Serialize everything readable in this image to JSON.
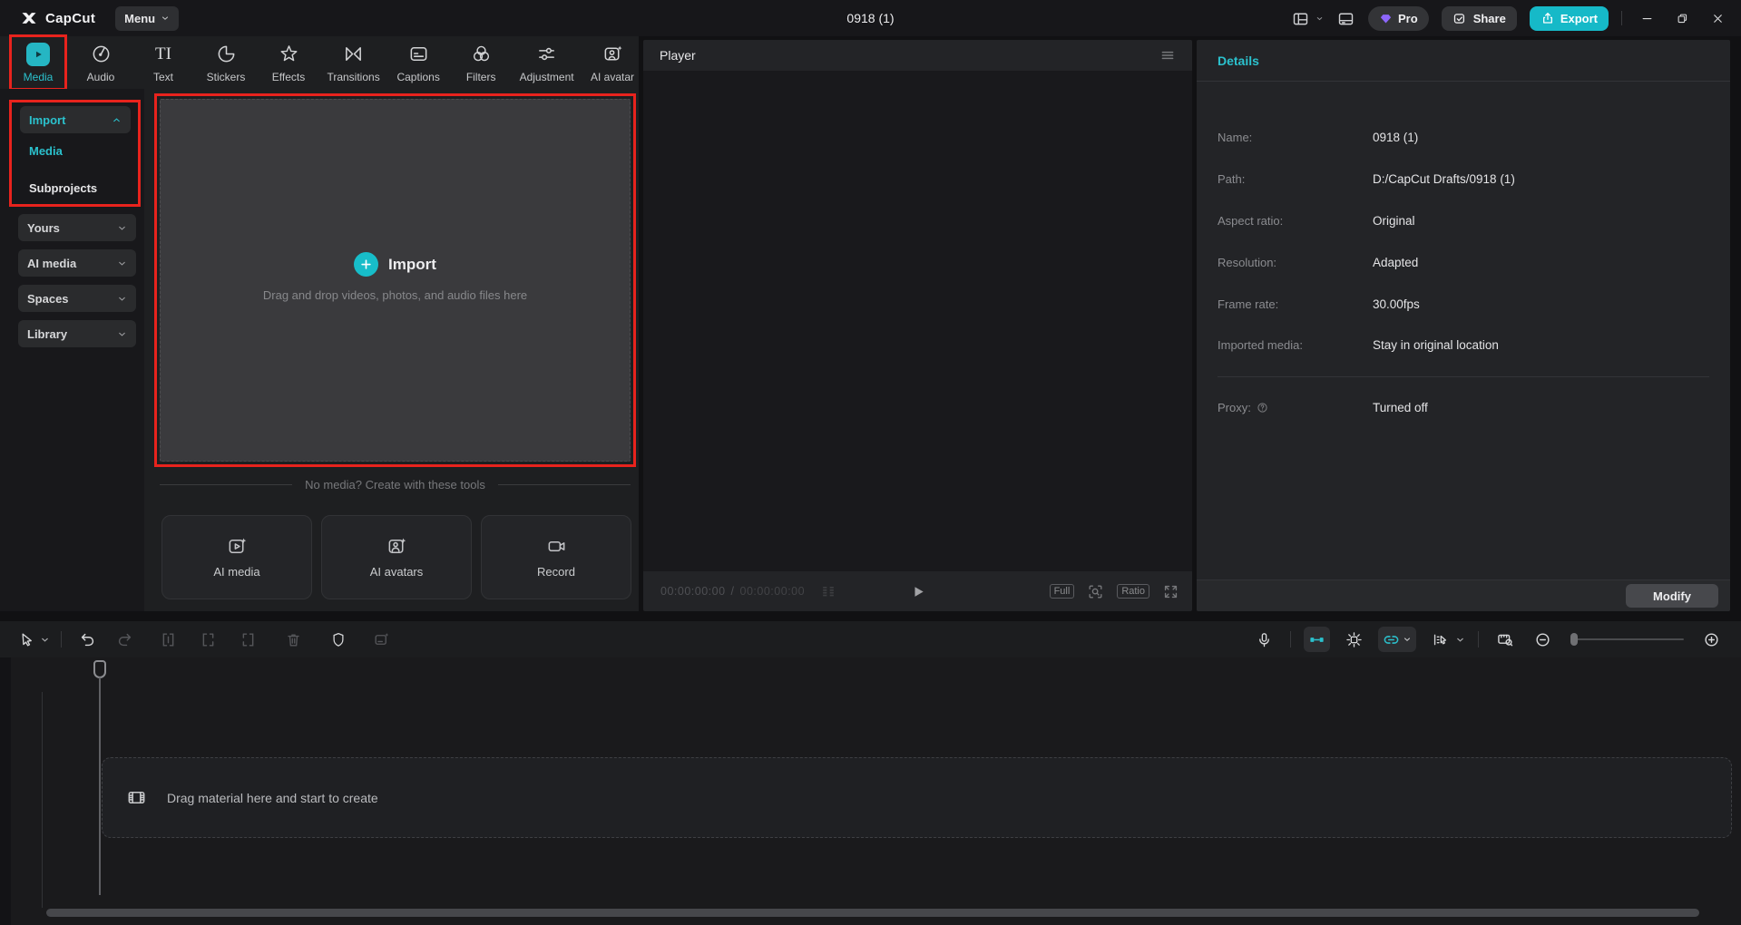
{
  "titlebar": {
    "app_name": "CapCut",
    "menu_label": "Menu",
    "project_title": "0918 (1)",
    "pro_label": "Pro",
    "share_label": "Share",
    "export_label": "Export"
  },
  "tabs": [
    {
      "label": "Media",
      "active": true
    },
    {
      "label": "Audio"
    },
    {
      "label": "Text"
    },
    {
      "label": "Stickers"
    },
    {
      "label": "Effects"
    },
    {
      "label": "Transitions"
    },
    {
      "label": "Captions"
    },
    {
      "label": "Filters"
    },
    {
      "label": "Adjustment"
    },
    {
      "label": "AI avatar"
    }
  ],
  "sidebar": {
    "import_label": "Import",
    "import_items": [
      {
        "label": "Media"
      },
      {
        "label": "Subprojects"
      }
    ],
    "groups": [
      {
        "label": "Yours"
      },
      {
        "label": "AI media"
      },
      {
        "label": "Spaces"
      },
      {
        "label": "Library"
      }
    ]
  },
  "import_zone": {
    "title": "Import",
    "subtitle": "Drag and drop videos, photos, and audio files here"
  },
  "create_tools": {
    "divider_label": "No media? Create with these tools",
    "buttons": [
      {
        "label": "AI media"
      },
      {
        "label": "AI avatars"
      },
      {
        "label": "Record"
      }
    ]
  },
  "player": {
    "title": "Player",
    "current_time": "00:00:00:00",
    "separator": "/",
    "total_time": "00:00:00:00",
    "full_label": "Full",
    "ratio_label": "Ratio"
  },
  "details": {
    "title": "Details",
    "rows": [
      {
        "label": "Name:",
        "value": "0918 (1)"
      },
      {
        "label": "Path:",
        "value": "D:/CapCut Drafts/0918 (1)"
      },
      {
        "label": "Aspect ratio:",
        "value": "Original"
      },
      {
        "label": "Resolution:",
        "value": "Adapted"
      },
      {
        "label": "Frame rate:",
        "value": "30.00fps"
      },
      {
        "label": "Imported media:",
        "value": "Stay in original location"
      }
    ],
    "proxy": {
      "label": "Proxy:",
      "value": "Turned off"
    },
    "modify_label": "Modify"
  },
  "timeline": {
    "dropzone_text": "Drag material here and start to create"
  },
  "colors": {
    "accent_cyan": "#2bc1cd",
    "export_button": "#16b9c8",
    "red_highlight": "#e8231d",
    "pro_gem_purple": "#8d66fb",
    "panel_background": "#232427",
    "window_background": "#17171a"
  }
}
